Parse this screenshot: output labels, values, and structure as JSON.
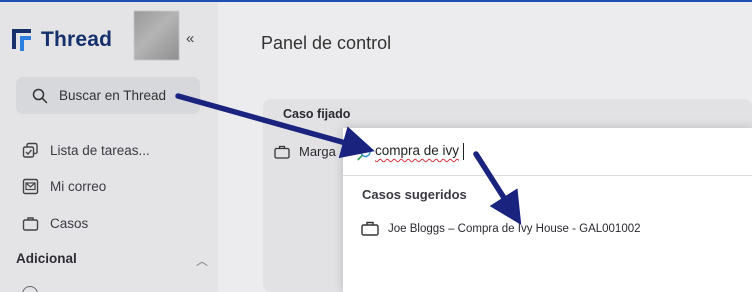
{
  "app": {
    "brand": "Thread",
    "collapse_glyph": "«"
  },
  "sidebar": {
    "search_label": "Buscar en Thread",
    "items": [
      {
        "label": "Lista de tareas...",
        "icon": "tasks-icon"
      },
      {
        "label": "Mi correo",
        "icon": "mail-icon"
      },
      {
        "label": "Casos",
        "icon": "briefcase-icon"
      }
    ],
    "section_title": "Adicional",
    "section_chevron": "︿"
  },
  "main": {
    "title": "Panel de control",
    "pinned_title": "Caso fijado",
    "pinned_case": "Marga"
  },
  "dropdown": {
    "query": "compra de ivy",
    "section_label": "Casos sugeridos",
    "result": "Joe Bloggs – Compra de Ivy House - GAL001002"
  },
  "colors": {
    "brand": "#15306b",
    "accent": "#1f4fb3",
    "annotation_arrow": "#1a237e",
    "spell_error": "#d8323a"
  }
}
